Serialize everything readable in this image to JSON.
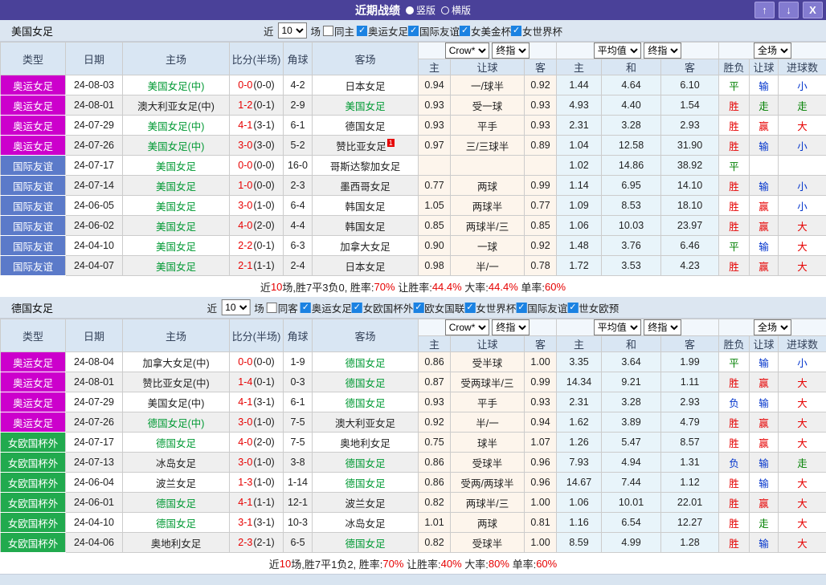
{
  "titlebar": {
    "title": "近期战绩",
    "radio_vertical": "竖版",
    "radio_horizontal": "横版",
    "selected_layout": "竖版",
    "buttons": {
      "up": "↑",
      "down": "↓",
      "close": "X"
    }
  },
  "colors": {
    "titlebar_bg": "#4a4199",
    "team_highlight": "#009933",
    "score_ft": "#e60000",
    "summary_red": "#e60000",
    "summary_text": "#222222"
  },
  "type_colors": {
    "奥运女足": "#cc00cc",
    "国际友谊": "#5b7ac9",
    "女欧国杯外": "#21aa4e"
  },
  "result_colors": {
    "胜": "#e60000",
    "赢": "#e60000",
    "大": "#e60000",
    "平": "#008000",
    "走": "#008000",
    "负": "#0033cc",
    "输": "#0033cc",
    "小": "#0033cc"
  },
  "sections": [
    {
      "team": "美国女足",
      "filter": {
        "near": "近",
        "count": "10",
        "games": "场",
        "same": {
          "label": "同主",
          "checked": false
        },
        "leagues": [
          {
            "label": "奥运女足",
            "checked": true
          },
          {
            "label": "国际友谊",
            "checked": true
          },
          {
            "label": "女美金杯",
            "checked": true
          },
          {
            "label": "女世界杯",
            "checked": true
          }
        ]
      },
      "controls": {
        "odds_source": "Crow*",
        "final1": "终指",
        "average": "平均值",
        "final2": "终指",
        "scope": "全场"
      },
      "columns": [
        "类型",
        "日期",
        "主场",
        "比分(半场)",
        "角球",
        "客场",
        "主",
        "让球",
        "客",
        "主",
        "和",
        "客",
        "胜负",
        "让球",
        "进球数"
      ],
      "rows": [
        {
          "type": "奥运女足",
          "date": "24-08-03",
          "home": "美国女足(中)",
          "home_hl": true,
          "score_ft": "0-0",
          "score_ht": "(0-0)",
          "corner": "4-2",
          "away": "日本女足",
          "away_hl": false,
          "away_sup": "",
          "h_odds": "0.94",
          "handicap": "一/球半",
          "a_odds": "0.92",
          "avg_h": "1.44",
          "avg_d": "4.64",
          "avg_a": "6.10",
          "result": "平",
          "handicap_result": "输",
          "goal_result": "小"
        },
        {
          "type": "奥运女足",
          "date": "24-08-01",
          "home": "澳大利亚女足(中)",
          "home_hl": false,
          "score_ft": "1-2",
          "score_ht": "(0-1)",
          "corner": "2-9",
          "away": "美国女足",
          "away_hl": true,
          "away_sup": "",
          "h_odds": "0.93",
          "handicap": "受一球",
          "a_odds": "0.93",
          "avg_h": "4.93",
          "avg_d": "4.40",
          "avg_a": "1.54",
          "result": "胜",
          "handicap_result": "走",
          "goal_result": "走"
        },
        {
          "type": "奥运女足",
          "date": "24-07-29",
          "home": "美国女足(中)",
          "home_hl": true,
          "score_ft": "4-1",
          "score_ht": "(3-1)",
          "corner": "6-1",
          "away": "德国女足",
          "away_hl": false,
          "away_sup": "",
          "h_odds": "0.93",
          "handicap": "平手",
          "a_odds": "0.93",
          "avg_h": "2.31",
          "avg_d": "3.28",
          "avg_a": "2.93",
          "result": "胜",
          "handicap_result": "赢",
          "goal_result": "大"
        },
        {
          "type": "奥运女足",
          "date": "24-07-26",
          "home": "美国女足(中)",
          "home_hl": true,
          "score_ft": "3-0",
          "score_ht": "(3-0)",
          "corner": "5-2",
          "away": "赞比亚女足",
          "away_hl": false,
          "away_sup": "1",
          "h_odds": "0.97",
          "handicap": "三/三球半",
          "a_odds": "0.89",
          "avg_h": "1.04",
          "avg_d": "12.58",
          "avg_a": "31.90",
          "result": "胜",
          "handicap_result": "输",
          "goal_result": "小"
        },
        {
          "type": "国际友谊",
          "date": "24-07-17",
          "home": "美国女足",
          "home_hl": true,
          "score_ft": "0-0",
          "score_ht": "(0-0)",
          "corner": "16-0",
          "away": "哥斯达黎加女足",
          "away_hl": false,
          "away_sup": "",
          "h_odds": "",
          "handicap": "",
          "a_odds": "",
          "avg_h": "1.02",
          "avg_d": "14.86",
          "avg_a": "38.92",
          "result": "平",
          "handicap_result": "",
          "goal_result": ""
        },
        {
          "type": "国际友谊",
          "date": "24-07-14",
          "home": "美国女足",
          "home_hl": true,
          "score_ft": "1-0",
          "score_ht": "(0-0)",
          "corner": "2-3",
          "away": "墨西哥女足",
          "away_hl": false,
          "away_sup": "",
          "h_odds": "0.77",
          "handicap": "两球",
          "a_odds": "0.99",
          "avg_h": "1.14",
          "avg_d": "6.95",
          "avg_a": "14.10",
          "result": "胜",
          "handicap_result": "输",
          "goal_result": "小"
        },
        {
          "type": "国际友谊",
          "date": "24-06-05",
          "home": "美国女足",
          "home_hl": true,
          "score_ft": "3-0",
          "score_ht": "(1-0)",
          "corner": "6-4",
          "away": "韩国女足",
          "away_hl": false,
          "away_sup": "",
          "h_odds": "1.05",
          "handicap": "两球半",
          "a_odds": "0.77",
          "avg_h": "1.09",
          "avg_d": "8.53",
          "avg_a": "18.10",
          "result": "胜",
          "handicap_result": "赢",
          "goal_result": "小"
        },
        {
          "type": "国际友谊",
          "date": "24-06-02",
          "home": "美国女足",
          "home_hl": true,
          "score_ft": "4-0",
          "score_ht": "(2-0)",
          "corner": "4-4",
          "away": "韩国女足",
          "away_hl": false,
          "away_sup": "",
          "h_odds": "0.85",
          "handicap": "两球半/三",
          "a_odds": "0.85",
          "avg_h": "1.06",
          "avg_d": "10.03",
          "avg_a": "23.97",
          "result": "胜",
          "handicap_result": "赢",
          "goal_result": "大"
        },
        {
          "type": "国际友谊",
          "date": "24-04-10",
          "home": "美国女足",
          "home_hl": true,
          "score_ft": "2-2",
          "score_ht": "(0-1)",
          "corner": "6-3",
          "away": "加拿大女足",
          "away_hl": false,
          "away_sup": "",
          "h_odds": "0.90",
          "handicap": "一球",
          "a_odds": "0.92",
          "avg_h": "1.48",
          "avg_d": "3.76",
          "avg_a": "6.46",
          "result": "平",
          "handicap_result": "输",
          "goal_result": "大"
        },
        {
          "type": "国际友谊",
          "date": "24-04-07",
          "home": "美国女足",
          "home_hl": true,
          "score_ft": "2-1",
          "score_ht": "(1-1)",
          "corner": "2-4",
          "away": "日本女足",
          "away_hl": false,
          "away_sup": "",
          "h_odds": "0.98",
          "handicap": "半/一",
          "a_odds": "0.78",
          "avg_h": "1.72",
          "avg_d": "3.53",
          "avg_a": "4.23",
          "result": "胜",
          "handicap_result": "赢",
          "goal_result": "大"
        }
      ],
      "summary": [
        [
          "近",
          "t"
        ],
        [
          "10",
          "r"
        ],
        [
          "场,胜7平3负0, 胜率:",
          "t"
        ],
        [
          "70%",
          "r"
        ],
        [
          " 让胜率:",
          "t"
        ],
        [
          "44.4%",
          "r"
        ],
        [
          " 大率:",
          "t"
        ],
        [
          "44.4%",
          "r"
        ],
        [
          " 单率:",
          "t"
        ],
        [
          "60%",
          "r"
        ]
      ]
    },
    {
      "team": "德国女足",
      "filter": {
        "near": "近",
        "count": "10",
        "games": "场",
        "same": {
          "label": "同客",
          "checked": false
        },
        "leagues": [
          {
            "label": "奥运女足",
            "checked": true
          },
          {
            "label": "女欧国杯外",
            "checked": true
          },
          {
            "label": "欧女国联",
            "checked": true
          },
          {
            "label": "女世界杯",
            "checked": true
          },
          {
            "label": "国际友谊",
            "checked": true
          },
          {
            "label": "世女欧预",
            "checked": true
          }
        ]
      },
      "controls": {
        "odds_source": "Crow*",
        "final1": "终指",
        "average": "平均值",
        "final2": "终指",
        "scope": "全场"
      },
      "columns": [
        "类型",
        "日期",
        "主场",
        "比分(半场)",
        "角球",
        "客场",
        "主",
        "让球",
        "客",
        "主",
        "和",
        "客",
        "胜负",
        "让球",
        "进球数"
      ],
      "rows": [
        {
          "type": "奥运女足",
          "date": "24-08-04",
          "home": "加拿大女足(中)",
          "home_hl": false,
          "score_ft": "0-0",
          "score_ht": "(0-0)",
          "corner": "1-9",
          "away": "德国女足",
          "away_hl": true,
          "away_sup": "",
          "h_odds": "0.86",
          "handicap": "受半球",
          "a_odds": "1.00",
          "avg_h": "3.35",
          "avg_d": "3.64",
          "avg_a": "1.99",
          "result": "平",
          "handicap_result": "输",
          "goal_result": "小"
        },
        {
          "type": "奥运女足",
          "date": "24-08-01",
          "home": "赞比亚女足(中)",
          "home_hl": false,
          "score_ft": "1-4",
          "score_ht": "(0-1)",
          "corner": "0-3",
          "away": "德国女足",
          "away_hl": true,
          "away_sup": "",
          "h_odds": "0.87",
          "handicap": "受两球半/三",
          "a_odds": "0.99",
          "avg_h": "14.34",
          "avg_d": "9.21",
          "avg_a": "1.11",
          "result": "胜",
          "handicap_result": "赢",
          "goal_result": "大"
        },
        {
          "type": "奥运女足",
          "date": "24-07-29",
          "home": "美国女足(中)",
          "home_hl": false,
          "score_ft": "4-1",
          "score_ht": "(3-1)",
          "corner": "6-1",
          "away": "德国女足",
          "away_hl": true,
          "away_sup": "",
          "h_odds": "0.93",
          "handicap": "平手",
          "a_odds": "0.93",
          "avg_h": "2.31",
          "avg_d": "3.28",
          "avg_a": "2.93",
          "result": "负",
          "handicap_result": "输",
          "goal_result": "大"
        },
        {
          "type": "奥运女足",
          "date": "24-07-26",
          "home": "德国女足(中)",
          "home_hl": true,
          "score_ft": "3-0",
          "score_ht": "(1-0)",
          "corner": "7-5",
          "away": "澳大利亚女足",
          "away_hl": false,
          "away_sup": "",
          "h_odds": "0.92",
          "handicap": "半/一",
          "a_odds": "0.94",
          "avg_h": "1.62",
          "avg_d": "3.89",
          "avg_a": "4.79",
          "result": "胜",
          "handicap_result": "赢",
          "goal_result": "大"
        },
        {
          "type": "女欧国杯外",
          "date": "24-07-17",
          "home": "德国女足",
          "home_hl": true,
          "score_ft": "4-0",
          "score_ht": "(2-0)",
          "corner": "7-5",
          "away": "奥地利女足",
          "away_hl": false,
          "away_sup": "",
          "h_odds": "0.75",
          "handicap": "球半",
          "a_odds": "1.07",
          "avg_h": "1.26",
          "avg_d": "5.47",
          "avg_a": "8.57",
          "result": "胜",
          "handicap_result": "赢",
          "goal_result": "大"
        },
        {
          "type": "女欧国杯外",
          "date": "24-07-13",
          "home": "冰岛女足",
          "home_hl": false,
          "score_ft": "3-0",
          "score_ht": "(1-0)",
          "corner": "3-8",
          "away": "德国女足",
          "away_hl": true,
          "away_sup": "",
          "h_odds": "0.86",
          "handicap": "受球半",
          "a_odds": "0.96",
          "avg_h": "7.93",
          "avg_d": "4.94",
          "avg_a": "1.31",
          "result": "负",
          "handicap_result": "输",
          "goal_result": "走"
        },
        {
          "type": "女欧国杯外",
          "date": "24-06-04",
          "home": "波兰女足",
          "home_hl": false,
          "score_ft": "1-3",
          "score_ht": "(1-0)",
          "corner": "1-14",
          "away": "德国女足",
          "away_hl": true,
          "away_sup": "",
          "h_odds": "0.86",
          "handicap": "受两/两球半",
          "a_odds": "0.96",
          "avg_h": "14.67",
          "avg_d": "7.44",
          "avg_a": "1.12",
          "result": "胜",
          "handicap_result": "输",
          "goal_result": "大"
        },
        {
          "type": "女欧国杯外",
          "date": "24-06-01",
          "home": "德国女足",
          "home_hl": true,
          "score_ft": "4-1",
          "score_ht": "(1-1)",
          "corner": "12-1",
          "away": "波兰女足",
          "away_hl": false,
          "away_sup": "",
          "h_odds": "0.82",
          "handicap": "两球半/三",
          "a_odds": "1.00",
          "avg_h": "1.06",
          "avg_d": "10.01",
          "avg_a": "22.01",
          "result": "胜",
          "handicap_result": "赢",
          "goal_result": "大"
        },
        {
          "type": "女欧国杯外",
          "date": "24-04-10",
          "home": "德国女足",
          "home_hl": true,
          "score_ft": "3-1",
          "score_ht": "(3-1)",
          "corner": "10-3",
          "away": "冰岛女足",
          "away_hl": false,
          "away_sup": "",
          "h_odds": "1.01",
          "handicap": "两球",
          "a_odds": "0.81",
          "avg_h": "1.16",
          "avg_d": "6.54",
          "avg_a": "12.27",
          "result": "胜",
          "handicap_result": "走",
          "goal_result": "大"
        },
        {
          "type": "女欧国杯外",
          "date": "24-04-06",
          "home": "奥地利女足",
          "home_hl": false,
          "score_ft": "2-3",
          "score_ht": "(2-1)",
          "corner": "6-5",
          "away": "德国女足",
          "away_hl": true,
          "away_sup": "",
          "h_odds": "0.82",
          "handicap": "受球半",
          "a_odds": "1.00",
          "avg_h": "8.59",
          "avg_d": "4.99",
          "avg_a": "1.28",
          "result": "胜",
          "handicap_result": "输",
          "goal_result": "大"
        }
      ],
      "summary": [
        [
          "近",
          "t"
        ],
        [
          "10",
          "r"
        ],
        [
          "场,胜7平1负2, 胜率:",
          "t"
        ],
        [
          "70%",
          "r"
        ],
        [
          " 让胜率:",
          "t"
        ],
        [
          "40%",
          "r"
        ],
        [
          " 大率:",
          "t"
        ],
        [
          "80%",
          "r"
        ],
        [
          " 单率:",
          "t"
        ],
        [
          "60%",
          "r"
        ]
      ]
    }
  ]
}
